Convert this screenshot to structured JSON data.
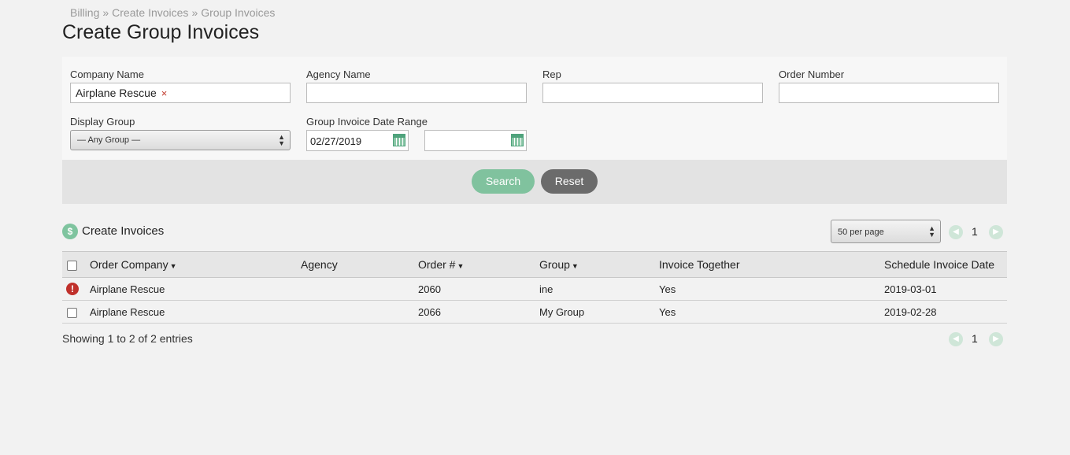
{
  "breadcrumb": {
    "items": [
      "Billing",
      "Create Invoices",
      "Group Invoices"
    ],
    "separator": "»"
  },
  "page_title": "Create Group Invoices",
  "filters": {
    "company_name": {
      "label": "Company Name",
      "token": "Airplane Rescue",
      "token_remove": "×"
    },
    "agency_name": {
      "label": "Agency Name",
      "value": ""
    },
    "rep": {
      "label": "Rep",
      "value": ""
    },
    "order_number": {
      "label": "Order Number",
      "value": ""
    },
    "display_group": {
      "label": "Display Group",
      "selected": "— Any Group —"
    },
    "date_range": {
      "label": "Group Invoice Date Range",
      "start": "02/27/2019",
      "end": ""
    }
  },
  "buttons": {
    "search": "Search",
    "reset": "Reset"
  },
  "section": {
    "icon": "$",
    "title": "Create Invoices"
  },
  "pagination": {
    "per_page": "50 per page",
    "current_page": "1"
  },
  "table": {
    "columns": [
      "Order Company",
      "Agency",
      "Order #",
      "Group",
      "Invoice Together",
      "Schedule Invoice Date"
    ],
    "rows": [
      {
        "status": "alert",
        "company": "Airplane Rescue",
        "agency": "",
        "order": "2060",
        "group": "ine",
        "together": "Yes",
        "date": "2019-03-01"
      },
      {
        "status": "checkbox",
        "company": "Airplane Rescue",
        "agency": "",
        "order": "2066",
        "group": "My Group",
        "together": "Yes",
        "date": "2019-02-28"
      }
    ]
  },
  "footer": {
    "info": "Showing 1 to 2 of 2 entries"
  },
  "colors": {
    "accent": "#80c29e",
    "reset": "#6b6b6b",
    "alert": "#c0302b"
  }
}
